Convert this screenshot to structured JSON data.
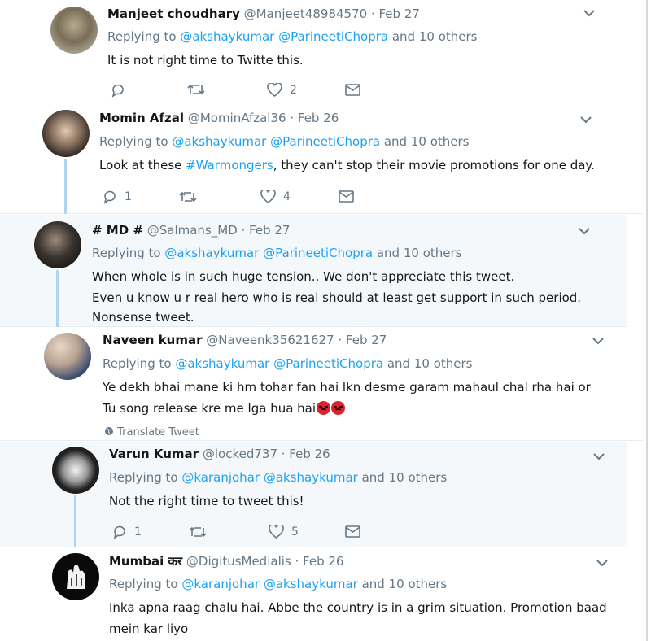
{
  "tweets": [
    {
      "name": "Manjeet choudhary",
      "handle": "@Manjeet48984570",
      "date": "· Feb 27",
      "replying_prefix": "Replying to",
      "mentions": [
        "@akshaykumar",
        "@ParineetiChopra"
      ],
      "others": "and 10 others",
      "lines": [
        "It is not right time to Twitte this."
      ],
      "replies": "",
      "likes": "2"
    },
    {
      "name": "Momin Afzal",
      "handle": "@MominAfzal36",
      "date": "· Feb 26",
      "replying_prefix": "Replying to",
      "mentions": [
        "@akshaykumar",
        "@ParineetiChopra"
      ],
      "others": "and 10 others",
      "text_before": "Look at these ",
      "hashtag": "#Warmongers",
      "text_after": ", they can't stop their movie promotions for one day.",
      "replies": "1",
      "likes": "4"
    },
    {
      "name": "# MD #",
      "handle": "@Salmans_MD",
      "date": "· Feb 27",
      "replying_prefix": "Replying to",
      "mentions": [
        "@akshaykumar",
        "@ParineetiChopra"
      ],
      "others": "and 10 others",
      "lines": [
        "When whole is in such huge tension.. We don't  appreciate this tweet.",
        "Even u know u r real hero  who is real should at least get support in such period.",
        "Nonsense tweet."
      ]
    },
    {
      "name": "Naveen kumar",
      "handle": "@Naveenk35621627",
      "date": "· Feb 27",
      "replying_prefix": "Replying to",
      "mentions": [
        "@akshaykumar",
        "@ParineetiChopra"
      ],
      "others": "and 10 others",
      "lines": [
        "Ye dekh bhai mane ki hm tohar fan hai lkn desme garam mahaul chal rha hai or",
        "Tu song release kre me lga hua hai"
      ],
      "translate": "Translate Tweet"
    },
    {
      "name": "Varun Kumar",
      "handle": "@locked737",
      "date": "· Feb 26",
      "replying_prefix": "Replying to",
      "mentions": [
        "@karanjohar",
        "@akshaykumar"
      ],
      "others": "and 10 others",
      "lines": [
        "Not the right time to tweet this!"
      ],
      "replies": "1",
      "likes": "5"
    },
    {
      "name": "Mumbai कर",
      "handle": "@DigitusMedialis",
      "date": "· Feb 26",
      "replying_prefix": "Replying to",
      "mentions": [
        "@karanjohar",
        "@akshaykumar"
      ],
      "others": "and 10 others",
      "lines": [
        "Inka apna raag chalu hai. Abbe the country is in a grim situation. Promotion baad",
        "mein kar liyo"
      ]
    }
  ],
  "icons": {
    "reply": "reply-icon",
    "retweet": "retweet-icon",
    "like": "heart-icon",
    "dm": "envelope-icon",
    "caret": "chevron-down-icon",
    "globe": "globe-icon"
  },
  "colors": {
    "link": "#1da1f2",
    "secondary": "#657786",
    "thread": "#aed4f0",
    "highlight_bg": "#f5f8fa"
  }
}
